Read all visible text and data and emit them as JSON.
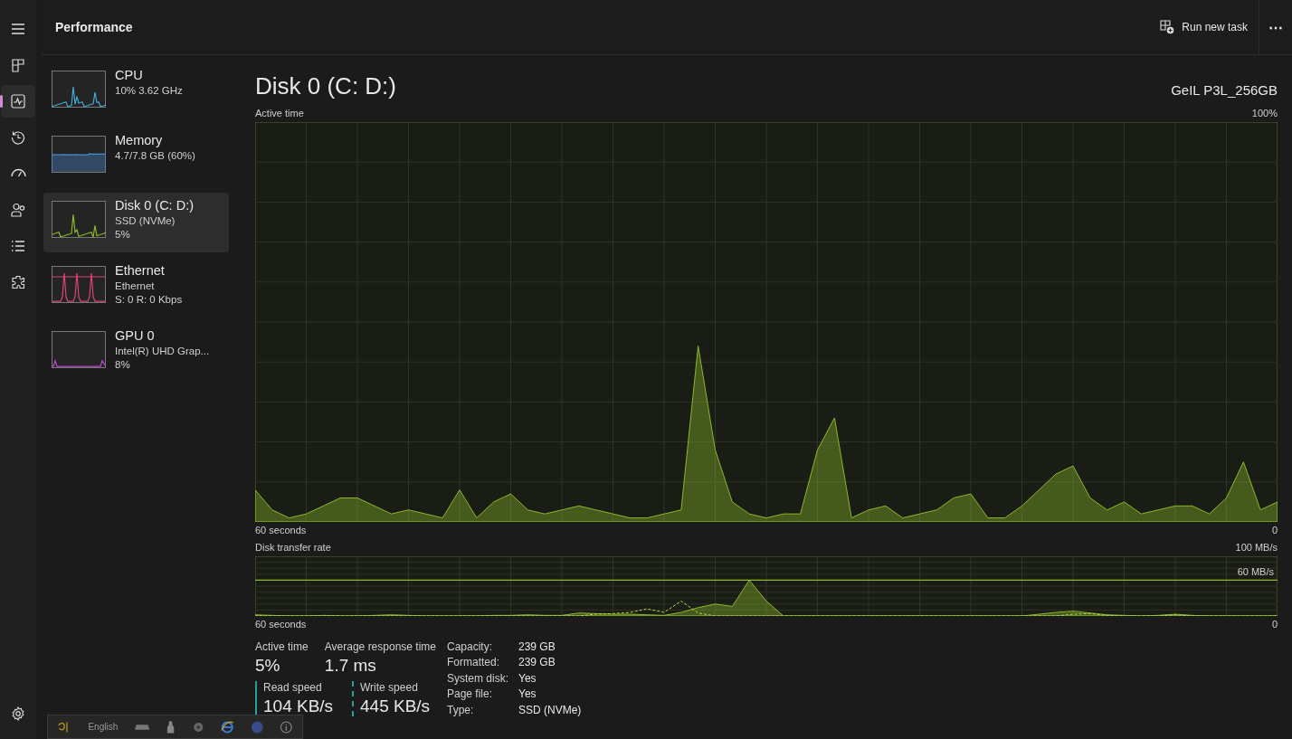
{
  "window": {
    "title": "Performance"
  },
  "toolbar": {
    "run_new_task": "Run new task",
    "more": "⋯"
  },
  "nav_items": [
    {
      "kind": "menu",
      "selected": false
    },
    {
      "kind": "processes",
      "selected": false
    },
    {
      "kind": "performance",
      "selected": true
    },
    {
      "kind": "history",
      "selected": false
    },
    {
      "kind": "startup",
      "selected": false
    },
    {
      "kind": "users",
      "selected": false
    },
    {
      "kind": "details",
      "selected": false
    },
    {
      "kind": "services",
      "selected": false
    },
    {
      "kind": "settings",
      "selected": false
    }
  ],
  "devices": [
    {
      "name": "CPU",
      "lines": [
        "10%  3.62 GHz"
      ],
      "kind": "spikes",
      "color": "#3fa9d8",
      "selected": false
    },
    {
      "name": "Memory",
      "lines": [
        "4.7/7.8 GB (60%)"
      ],
      "kind": "fill",
      "color": "#4a8fd8",
      "selected": false
    },
    {
      "name": "Disk 0 (C: D:)",
      "lines": [
        "SSD (NVMe)",
        "5%"
      ],
      "kind": "spikes",
      "color": "#8cb82a",
      "selected": true
    },
    {
      "name": "Ethernet",
      "lines": [
        "Ethernet",
        "S: 0 R: 0 Kbps"
      ],
      "kind": "peaks",
      "color": "#d9437a",
      "selected": false
    },
    {
      "name": "GPU 0",
      "lines": [
        "Intel(R) UHD Grap...",
        "8%"
      ],
      "kind": "low",
      "color": "#b84ad0",
      "selected": false
    }
  ],
  "detail": {
    "title": "Disk 0 (C: D:)",
    "model": "GeIL P3L_256GB",
    "active_chart": {
      "title": "Active time",
      "max_label": "100%",
      "span_label": "60 seconds",
      "min_label": "0"
    },
    "transfer_chart": {
      "title": "Disk transfer rate",
      "max_label": "100 MB/s",
      "span_label": "60 seconds",
      "min_label": "0",
      "reference_label": "60 MB/s"
    },
    "stats": [
      {
        "label": "Active time",
        "value": "5%"
      },
      {
        "label": "Average response time",
        "value": "1.7 ms"
      }
    ],
    "speeds": [
      {
        "label": "Read speed",
        "value": "104 KB/s",
        "kind": "solid"
      },
      {
        "label": "Write speed",
        "value": "445 KB/s",
        "kind": "dashed"
      }
    ],
    "properties": [
      {
        "label": "Capacity:",
        "value": "239 GB"
      },
      {
        "label": "Formatted:",
        "value": "239 GB"
      },
      {
        "label": "System disk:",
        "value": "Yes"
      },
      {
        "label": "Page file:",
        "value": "Yes"
      },
      {
        "label": "Type:",
        "value": "SSD (NVMe)"
      }
    ]
  },
  "language_bar": {
    "label": "English"
  }
}
